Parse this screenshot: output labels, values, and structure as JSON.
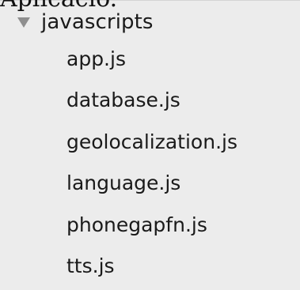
{
  "top_fragment": "Aplicació.",
  "tree": {
    "folder": {
      "label": "javascripts",
      "icon": "disclosure-triangle-down",
      "expanded": true
    },
    "files": [
      {
        "name": "app.js"
      },
      {
        "name": "database.js"
      },
      {
        "name": "geolocalization.js"
      },
      {
        "name": "language.js"
      },
      {
        "name": "phonegapfn.js"
      },
      {
        "name": "tts.js"
      }
    ]
  },
  "colors": {
    "panel_bg": "#ececec",
    "text": "#1a1a1a",
    "disclosure": "#8f8f8f"
  }
}
